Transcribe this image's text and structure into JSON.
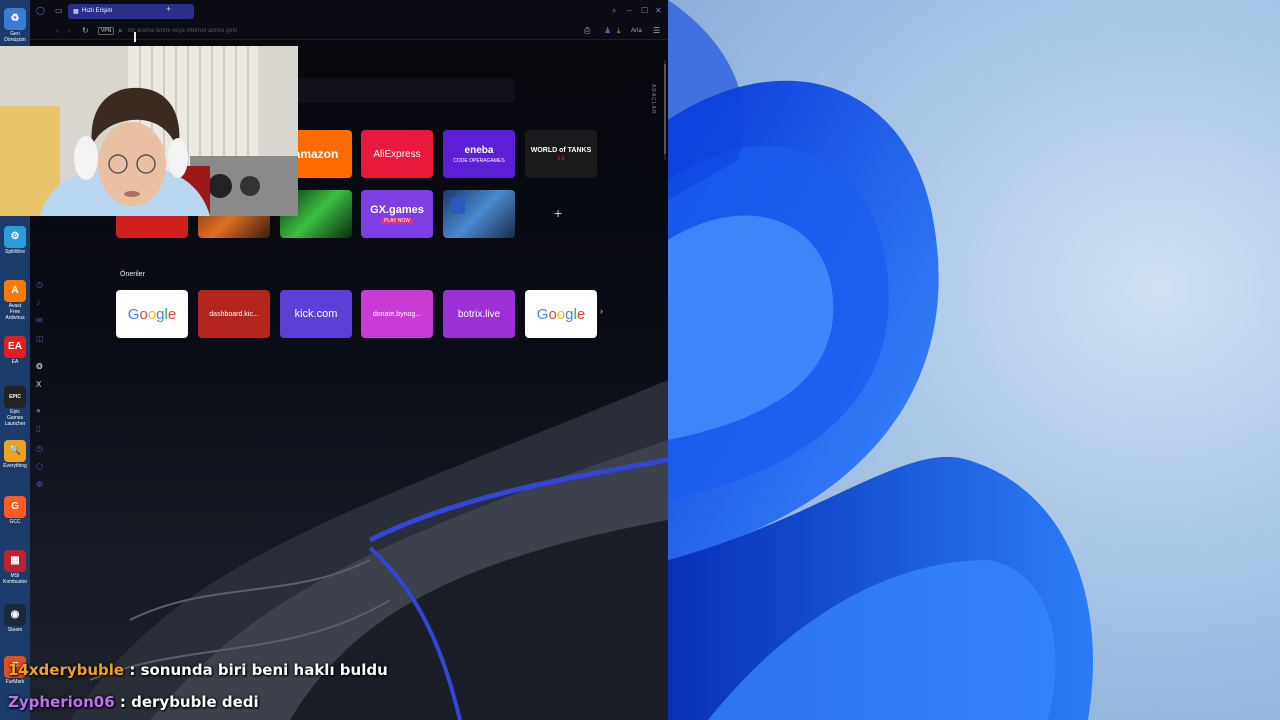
{
  "desktop": {
    "icons": [
      {
        "label": "Geri Dönüşüm",
        "icon": "recycle-bin-icon",
        "color": "#3a7bd5",
        "glyph": "♻"
      },
      {
        "label": "SplitWire",
        "icon": "splitwire-icon",
        "color": "#2d9cdb",
        "glyph": "⚙"
      },
      {
        "label": "Avast Free Antivirus",
        "icon": "avast-icon",
        "color": "#ff7800",
        "glyph": "A"
      },
      {
        "label": "EA",
        "icon": "ea-icon",
        "color": "#e02020",
        "glyph": "EA"
      },
      {
        "label": "Epic Games Launcher",
        "icon": "epic-games-icon",
        "color": "#222222",
        "glyph": "EPIC"
      },
      {
        "label": "Everything",
        "icon": "everything-icon",
        "color": "#f0a020",
        "glyph": "🔍"
      },
      {
        "label": "GCC",
        "icon": "gcc-icon",
        "color": "#ff5a1f",
        "glyph": "G"
      },
      {
        "label": "MSI Kombustor",
        "icon": "msi-icon",
        "color": "#c02030",
        "glyph": "▦"
      },
      {
        "label": "Steam",
        "icon": "steam-icon",
        "color": "#1b2838",
        "glyph": "◉"
      },
      {
        "label": "FurMark",
        "icon": "furmark-icon",
        "color": "#e05020",
        "glyph": "F"
      }
    ]
  },
  "browser": {
    "tab_title": "Hızlı Erişim",
    "address_placeholder": "Bir arama terimi veya internet adresi girin",
    "vpn_label": "VPN",
    "ai_label": "Aria",
    "tools_label": "ARAÇLAR",
    "suggestions_label": "Öneriler",
    "speed_dial": [
      {
        "label": "amazon",
        "bg": "#ff6a00",
        "color": "#ffffff"
      },
      {
        "label": "AliExpress",
        "bg": "#e8193c",
        "color": "#ffffff"
      },
      {
        "label": "eneba",
        "sub": "CODE OPERAGAMES",
        "bg": "#5b20d6",
        "color": "#ffffff"
      },
      {
        "label": "WORLD of TANKS",
        "sub": "2.0",
        "bg": "#1a1a1a",
        "color": "#ffffff"
      },
      {
        "label": "GX.games",
        "sub": "PLAY NOW",
        "bg": "#7b3fe4",
        "color": "#ffffff"
      }
    ],
    "suggestions": [
      {
        "label": "Google",
        "bg": "#ffffff"
      },
      {
        "label": "dashboard.kic...",
        "bg": "#b3261e"
      },
      {
        "label": "kick.com",
        "bg": "#5b3fd6"
      },
      {
        "label": "donate.bynog...",
        "bg": "#c83bd4"
      },
      {
        "label": "botrix.live",
        "bg": "#9d2fd6"
      },
      {
        "label": "Google",
        "bg": "#ffffff"
      }
    ],
    "accent": "#5458c8"
  },
  "chat": [
    {
      "user": "14xderybuble",
      "user_color": "#f0a030",
      "message": "sonunda biri beni haklı buldu"
    },
    {
      "user": "Zypherion06",
      "user_color": "#c070f0",
      "message": "derybuble dedi"
    }
  ]
}
